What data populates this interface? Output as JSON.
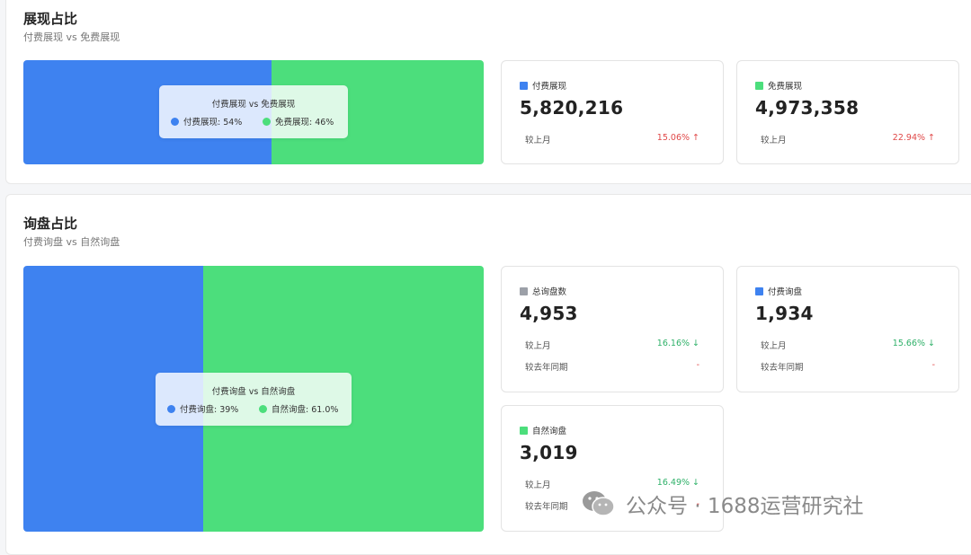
{
  "section1": {
    "title": "展现占比",
    "subtitle": "付费展现 vs 免费展现",
    "chart_data": {
      "type": "bar",
      "categories": [
        "付费展现",
        "免费展现"
      ],
      "values": [
        54,
        46
      ],
      "colors": [
        "#3e82f0",
        "#4cde7c"
      ]
    },
    "tooltip": {
      "title": "付费展现 vs 免费展现",
      "items": [
        {
          "label": "付费展现: 54%",
          "color": "#3e82f0"
        },
        {
          "label": "免费展现: 46%",
          "color": "#4cde7c"
        }
      ]
    },
    "cards": [
      {
        "label": "付费展现",
        "color": "#3e82f0",
        "value": "5,820,216",
        "rows": [
          {
            "label": "较上月",
            "value": "15.06% ↑",
            "trend": "up"
          }
        ]
      },
      {
        "label": "免费展现",
        "color": "#4cde7c",
        "value": "4,973,358",
        "rows": [
          {
            "label": "较上月",
            "value": "22.94% ↑",
            "trend": "up"
          }
        ]
      }
    ]
  },
  "section2": {
    "title": "询盘占比",
    "subtitle": "付费询盘 vs 自然询盘",
    "chart_data": {
      "type": "bar",
      "categories": [
        "付费询盘",
        "自然询盘"
      ],
      "values": [
        39,
        61.0
      ],
      "colors": [
        "#3e82f0",
        "#4cde7c"
      ]
    },
    "tooltip": {
      "title": "付费询盘 vs 自然询盘",
      "items": [
        {
          "label": "付费询盘: 39%",
          "color": "#3e82f0"
        },
        {
          "label": "自然询盘: 61.0%",
          "color": "#4cde7c"
        }
      ]
    },
    "cards": [
      {
        "label": "总询盘数",
        "color": "#9ca0a8",
        "value": "4,953",
        "rows": [
          {
            "label": "较上月",
            "value": "16.16% ↓",
            "trend": "down"
          },
          {
            "label": "较去年同期",
            "value": "-",
            "trend": "none"
          }
        ]
      },
      {
        "label": "付费询盘",
        "color": "#3e82f0",
        "value": "1,934",
        "rows": [
          {
            "label": "较上月",
            "value": "15.66% ↓",
            "trend": "down"
          },
          {
            "label": "较去年同期",
            "value": "-",
            "trend": "none"
          }
        ]
      },
      {
        "label": "自然询盘",
        "color": "#4cde7c",
        "value": "3,019",
        "rows": [
          {
            "label": "较上月",
            "value": "16.49% ↓",
            "trend": "down"
          },
          {
            "label": "较去年同期",
            "value": "-",
            "trend": "none"
          }
        ]
      }
    ]
  },
  "watermark": {
    "icon": "wechat-icon",
    "text": "公众号 · 1688运营研究社"
  }
}
